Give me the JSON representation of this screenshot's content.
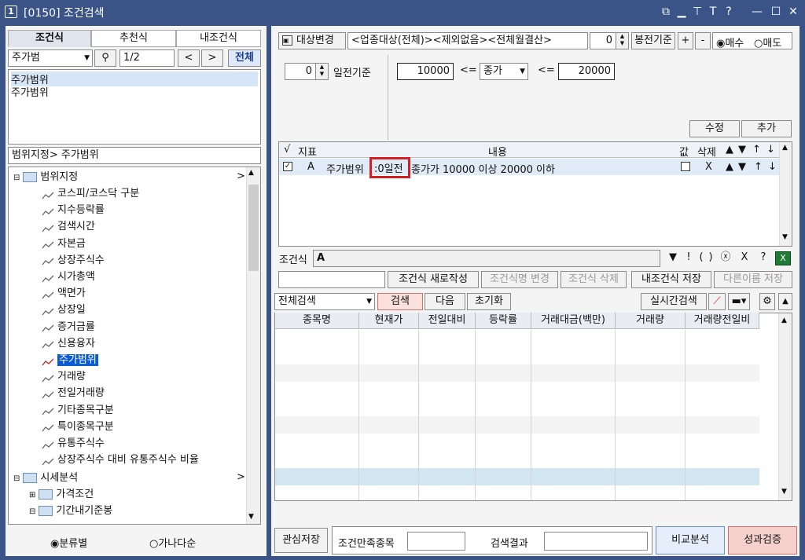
{
  "window": {
    "icon": "1",
    "title": "[0150] 조건검색",
    "controls": [
      "copy-icon",
      "minimize-icon",
      "pin-icon",
      "font-size-icon",
      "help-icon",
      "minimize-window-icon",
      "maximize-icon",
      "close-icon"
    ]
  },
  "left": {
    "tabs": [
      "조건식",
      "추천식",
      "내조건식"
    ],
    "search": {
      "value": "주가범",
      "page": "1/2",
      "prev": "<",
      "next": ">",
      "all": "전체"
    },
    "results": [
      "주가범위",
      "주가범위"
    ],
    "range_label": "범위지정> 주가범위",
    "tree": {
      "range_group": "범위지정",
      "range_items": [
        "코스피/코스닥 구분",
        "지수등락률",
        "검색시간",
        "자본금",
        "상장주식수",
        "시가총액",
        "액면가",
        "상장일",
        "증거금률",
        "신용융자",
        "주가범위",
        "거래량",
        "전일거래량",
        "기타종목구분",
        "특이종목구분",
        "유통주식수",
        "상장주식수 대비 유통주식수 비율"
      ],
      "market_group": "시세분석",
      "market_items": [
        "가격조건",
        "기간내기준봉"
      ]
    },
    "radio": {
      "by_category": "분류별",
      "by_alpha": "가나다순"
    }
  },
  "top": {
    "target_button": "대상변경",
    "target_text": "<업종대상(전체)><제외없음><전체월결산>",
    "candle_value": "0",
    "candle_label": "봉전기준",
    "plus": "+",
    "minus": "-",
    "buy": "매수",
    "sell": "매도",
    "days_value": "0",
    "days_label": "일전기준",
    "min_value": "10000",
    "lte1": "<=",
    "price_type": "종가",
    "lte2": "<=",
    "max_value": "20000",
    "edit": "수정",
    "add": "추가"
  },
  "condition_table": {
    "headers": [
      "√",
      "지표",
      "내용",
      "값",
      "삭제",
      "▲",
      "▼",
      "↑",
      "↓"
    ],
    "row": {
      "indicator": "A",
      "content_prefix": "주가범위",
      "content_highlight": ":0일전",
      "content_suffix": "종가가 10000 이상 20000 이하",
      "delete": "X",
      "up": "▲",
      "down": "▼",
      "top": "↑",
      "bottom": "↓"
    }
  },
  "formula": {
    "label": "조건식",
    "value": "A",
    "ops": [
      "▼",
      "!",
      "(",
      ")",
      "ⓧ",
      "X",
      "?"
    ]
  },
  "actions": {
    "new": "조건식 새로작성",
    "rename": "조건식명 변경",
    "delete": "조건식 삭제",
    "save": "내조건식 저장",
    "save_as": "다른이름 저장"
  },
  "search_bar": {
    "scope": "전체검색",
    "search": "검색",
    "next": "다음",
    "reset": "초기화",
    "realtime": "실시간검색"
  },
  "result_table": {
    "headers": [
      "종목명",
      "현재가",
      "전일대비",
      "등락률",
      "거래대금(백만)",
      "거래량",
      "거래량전일비"
    ]
  },
  "bottom": {
    "watch_save": "관심저장",
    "matched_label": "조건만족종목",
    "matched_value": "",
    "result_label": "검색결과",
    "result_value": "",
    "compare": "비교분석",
    "perf": "성과검증"
  },
  "colors": {
    "title_bg": "#3b5488",
    "highlight": "#d21f1f",
    "selected": "#0a5bd6",
    "perf": "#f6d0cc",
    "compare": "#e6eefb"
  }
}
